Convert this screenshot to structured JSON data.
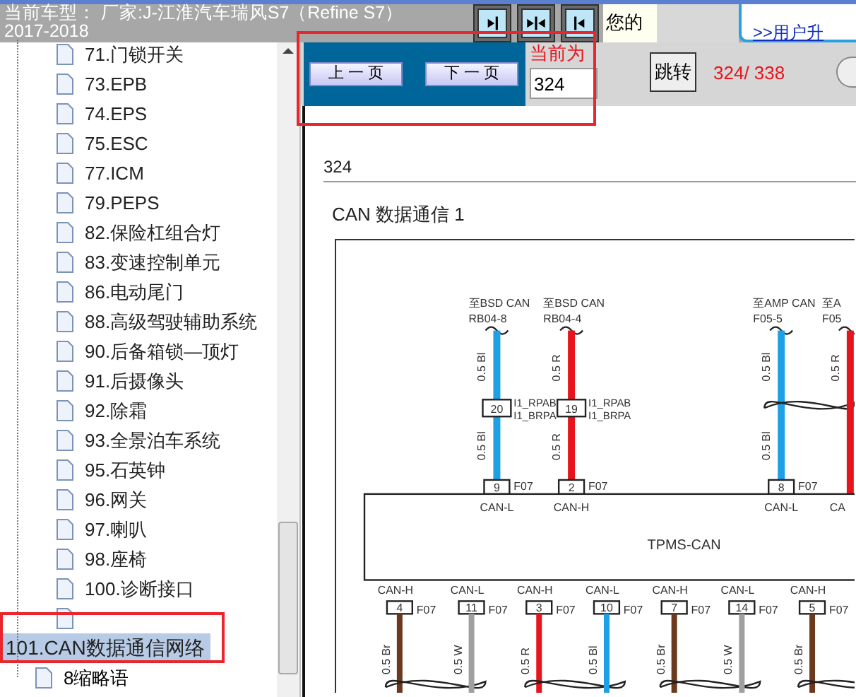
{
  "header": {
    "title": "当前车型： 厂家:J-江淮汽车瑞风S7（Refine S7） 2017-2018",
    "greeting": "您的",
    "upgrade_link": ">>用户升"
  },
  "tree": [
    {
      "children": [
        {
          "label": "71.门锁开关",
          "selected": false
        },
        {
          "label": "73.EPB",
          "selected": false
        },
        {
          "label": "74.EPS",
          "selected": false
        },
        {
          "label": "75.ESC",
          "selected": false
        },
        {
          "label": "77.ICM",
          "selected": false
        },
        {
          "label": "79.PEPS",
          "selected": false
        },
        {
          "label": "82.保险杠组合灯",
          "selected": false
        },
        {
          "label": "83.变速控制单元",
          "selected": false
        },
        {
          "label": "86.电动尾门",
          "selected": false
        },
        {
          "label": "88.高级驾驶辅助系统",
          "selected": false
        },
        {
          "label": "90.后备箱锁—顶灯",
          "selected": false
        },
        {
          "label": "91.后摄像头",
          "selected": false
        },
        {
          "label": "92.除霜",
          "selected": false
        },
        {
          "label": "93.全景泊车系统",
          "selected": false
        },
        {
          "label": "95.石英钟",
          "selected": false
        },
        {
          "label": "96.网关",
          "selected": false
        },
        {
          "label": "97.喇叭",
          "selected": false
        },
        {
          "label": "98.座椅",
          "selected": false
        },
        {
          "label": "100.诊断接口",
          "selected": false
        },
        {
          "label": "101.CAN数据通信网络",
          "selected": true
        }
      ]
    },
    {
      "label": "8缩略语",
      "selected": false
    }
  ],
  "pager": {
    "prev": "上 一 页",
    "next": "下 一 页",
    "current_label": "当前为",
    "current_value": "324",
    "jump": "跳转",
    "total": "324/ 338"
  },
  "document": {
    "page": "324",
    "title": "CAN 数据通信 1",
    "top_wires": [
      {
        "kind": "inline",
        "to": "至BSD CAN",
        "connector": "RB04-8",
        "color": "#1ea0e6",
        "gauge_upper": "0.5 Bl",
        "inline_pin": "20",
        "inline_labels": [
          "I1_RPAB",
          "I1_BRPA"
        ],
        "gauge_lower": "0.5 Bl",
        "pin": "9",
        "pin_connector": "F07",
        "signal": "CAN-L"
      },
      {
        "kind": "inline",
        "to": "至BSD CAN",
        "connector": "RB04-4",
        "color": "#e8141c",
        "gauge_upper": "0.5 R",
        "inline_pin": "19",
        "inline_labels": [
          "I1_RPAB",
          "I1_BRPA"
        ],
        "gauge_lower": "0.5 R",
        "pin": "2",
        "pin_connector": "F07",
        "signal": "CAN-H"
      },
      {
        "kind": "twisted",
        "to": "至AMP CAN",
        "connector": "F05-5",
        "color": "#1ea0e6",
        "gauge_upper": "0.5 Bl",
        "gauge_lower": "0.5 Bl",
        "pin": "8",
        "pin_connector": "F07",
        "signal": "CAN-L"
      },
      {
        "kind": "twisted",
        "to": "至A",
        "connector": "F05",
        "color": "#e8141c",
        "gauge_upper": "0.5 R",
        "signal": "CA"
      }
    ],
    "module": "TPMS-CAN",
    "bottom_wires": [
      {
        "signal": "CAN-H",
        "pin": "4",
        "pin_connector": "F07",
        "color": "#6b3a1e",
        "gauge": "0.5 Br"
      },
      {
        "signal": "CAN-L",
        "pin": "11",
        "pin_connector": "F07",
        "color": "#a0a0a0",
        "gauge": "0.5 W"
      },
      {
        "signal": "CAN-H",
        "pin": "3",
        "pin_connector": "F07",
        "color": "#e8141c",
        "gauge": "0.5 R"
      },
      {
        "signal": "CAN-L",
        "pin": "10",
        "pin_connector": "F07",
        "color": "#1ea0e6",
        "gauge": "0.5 Bl"
      },
      {
        "signal": "CAN-H",
        "pin": "7",
        "pin_connector": "F07",
        "color": "#6b3a1e",
        "gauge": "0.5 Br"
      },
      {
        "signal": "CAN-L",
        "pin": "14",
        "pin_connector": "F07",
        "color": "#a0a0a0",
        "gauge": "0.5 W"
      },
      {
        "signal": "CAN-H",
        "pin": "5",
        "pin_connector": "F07",
        "color": "#6b3a1e",
        "gauge": "0.5 Br"
      }
    ]
  }
}
